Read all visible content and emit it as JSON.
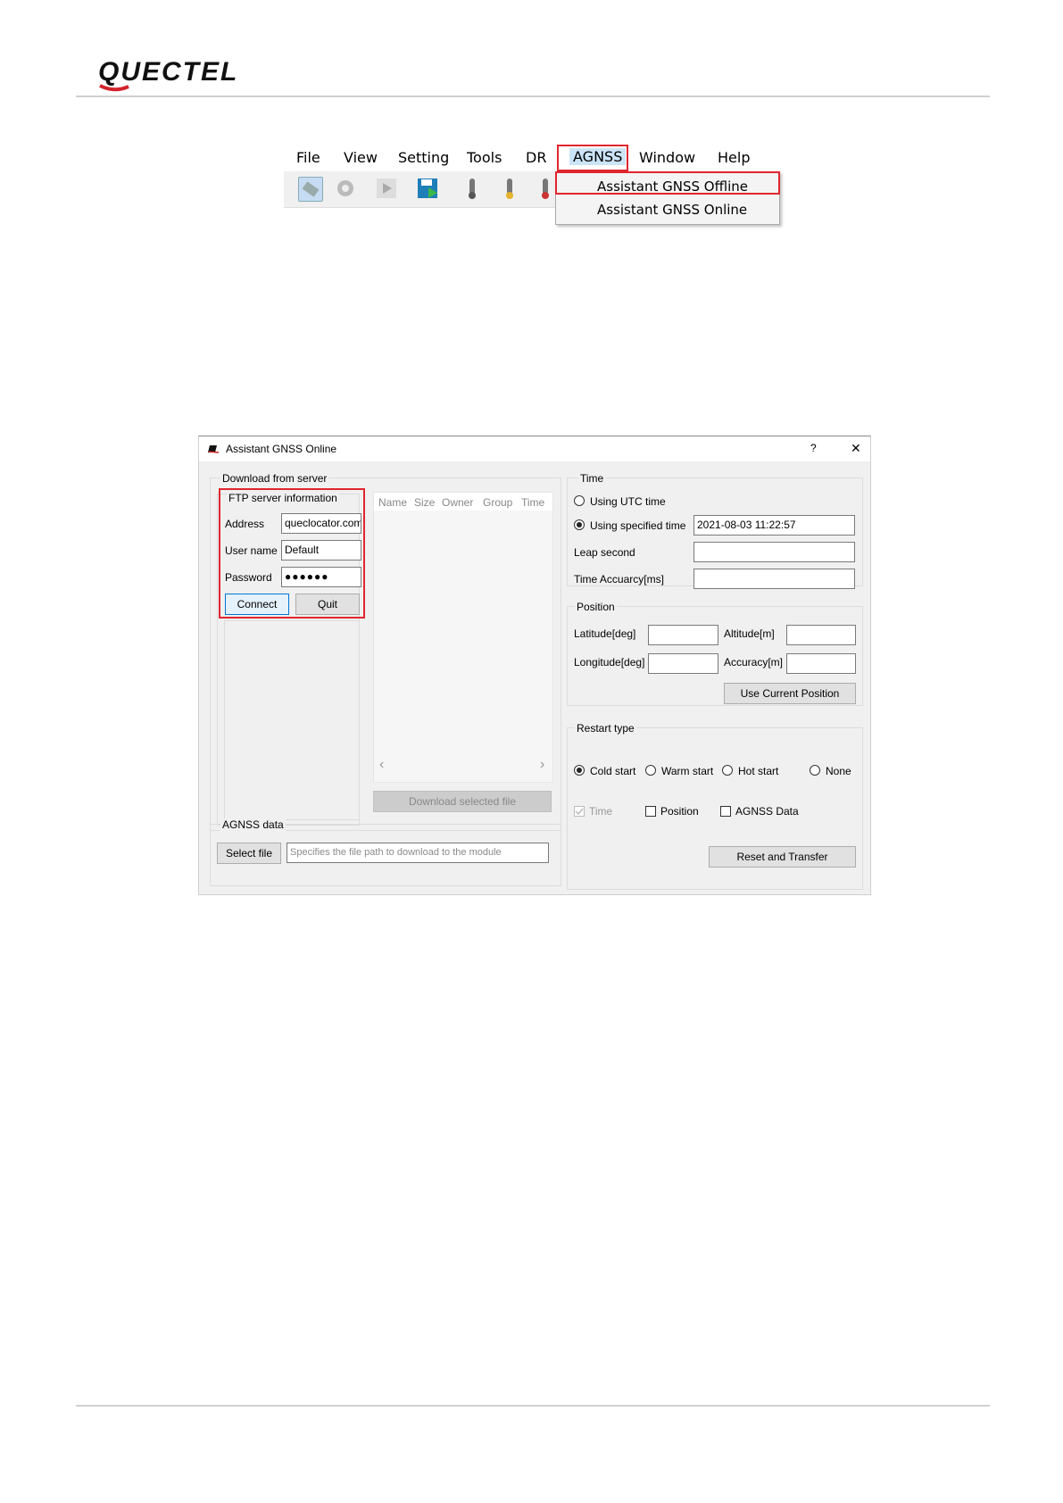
{
  "brand": {
    "logo_text": "QUECTEL"
  },
  "menu_screenshot": {
    "menu_items": [
      "File",
      "View",
      "Setting",
      "Tools",
      "DR",
      "AGNSS",
      "Window",
      "Help"
    ],
    "dropdown": [
      "Assistant GNSS Offline",
      "Assistant GNSS Online"
    ]
  },
  "dialog": {
    "title": "Assistant GNSS Online",
    "help": "?",
    "close": "✕",
    "download_group": "Download from server",
    "ftp_group": "FTP server information",
    "address_label": "Address",
    "address_value": "queclocator.com",
    "username_label": "User name",
    "username_value": "Default",
    "password_label": "Password",
    "password_value": "●●●●●●",
    "connect": "Connect",
    "quit": "Quit",
    "file_columns": [
      "Name",
      "Size",
      "Owner",
      "Group",
      "Time"
    ],
    "scroll_left": "‹",
    "scroll_right": "›",
    "download_selected": "Download selected file",
    "agnss_group": "AGNSS data",
    "select_file": "Select file",
    "file_path_placeholder": "Specifies the file path to download to the module",
    "time_group": "Time",
    "using_utc": "Using UTC time",
    "using_specified": "Using specified time",
    "specified_time_value": "2021-08-03 11:22:57",
    "leap_second": "Leap second",
    "time_accuracy": "Time Accuarcy[ms]",
    "position_group": "Position",
    "latitude": "Latitude[deg]",
    "altitude": "Altitude[m]",
    "longitude": "Longitude[deg]",
    "accuracy": "Accuracy[m]",
    "use_current_position": "Use Current Position",
    "restart_group": "Restart type",
    "cold_start": "Cold start",
    "warm_start": "Warm start",
    "hot_start": "Hot start",
    "none": "None",
    "chk_time": "Time",
    "chk_position": "Position",
    "chk_agnss": "AGNSS Data",
    "reset_transfer": "Reset and Transfer"
  }
}
